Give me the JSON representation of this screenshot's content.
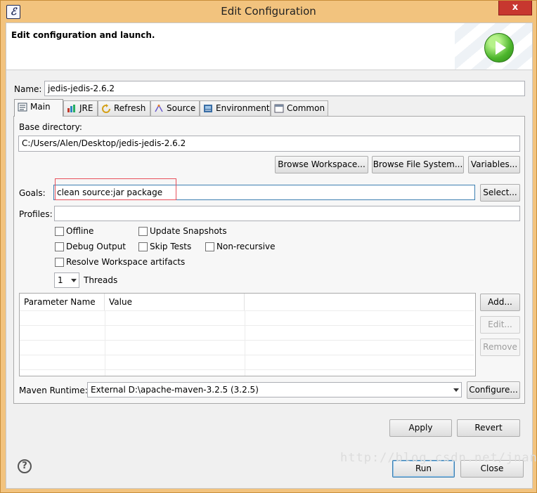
{
  "window": {
    "title": "Edit Configuration",
    "close_glyph": "x"
  },
  "header": {
    "text": "Edit configuration and launch."
  },
  "name": {
    "label": "Name:",
    "value": "jedis-jedis-2.6.2"
  },
  "tabs": [
    {
      "label": "Main",
      "icon": "main-tab-icon"
    },
    {
      "label": "JRE",
      "icon": "jre-tab-icon"
    },
    {
      "label": "Refresh",
      "icon": "refresh-tab-icon"
    },
    {
      "label": "Source",
      "icon": "source-tab-icon"
    },
    {
      "label": "Environment",
      "icon": "environment-tab-icon"
    },
    {
      "label": "Common",
      "icon": "common-tab-icon"
    }
  ],
  "main": {
    "base_directory_label": "Base directory:",
    "base_directory_value": "C:/Users/Alen/Desktop/jedis-jedis-2.6.2",
    "browse_workspace": "Browse Workspace...",
    "browse_file_system": "Browse File System...",
    "variables": "Variables...",
    "goals_label": "Goals:",
    "goals_value": "clean source:jar package",
    "select": "Select...",
    "profiles_label": "Profiles:",
    "profiles_value": "",
    "checkboxes": {
      "offline": "Offline",
      "update_snapshots": "Update Snapshots",
      "debug_output": "Debug Output",
      "skip_tests": "Skip Tests",
      "non_recursive": "Non-recursive",
      "resolve_workspace": "Resolve Workspace artifacts"
    },
    "threads_value": "1",
    "threads_label": "Threads",
    "table": {
      "col_name": "Parameter Name",
      "col_value": "Value"
    },
    "add": "Add...",
    "edit": "Edit...",
    "remove": "Remove",
    "runtime_label": "Maven Runtime:",
    "runtime_value": "External D:\\apache-maven-3.2.5 (3.2.5)",
    "configure": "Configure..."
  },
  "buttons": {
    "apply": "Apply",
    "revert": "Revert",
    "run": "Run",
    "close": "Close"
  },
  "help_glyph": "?",
  "watermark": "http://blog.csdn.net/jnanxu",
  "colors": {
    "title_bar": "#f2c37e",
    "close": "#c7372f",
    "highlight": "#e8505b"
  }
}
